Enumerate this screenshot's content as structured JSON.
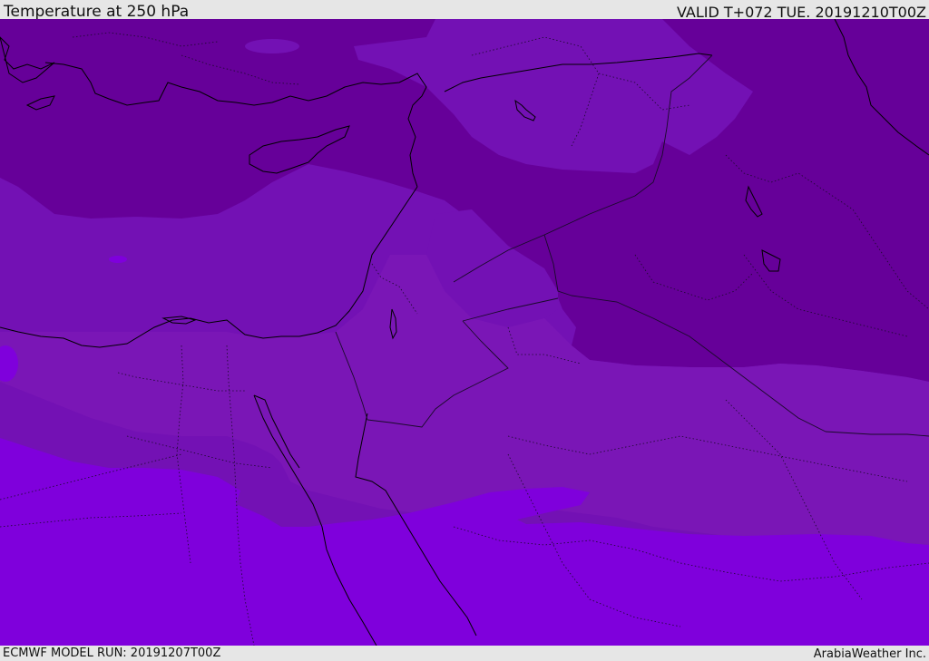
{
  "header": {
    "title": "Temperature at 250 hPa",
    "valid_time": "VALID T+072 TUE. 20191210T00Z"
  },
  "footer": {
    "model_run": "ECMWF MODEL RUN: 20191207T00Z",
    "credit": "ArabiaWeather Inc."
  },
  "map": {
    "colors": {
      "band_coldest": "#660099",
      "band_cold": "#7311b4",
      "band_mid": "#7a16b6",
      "band_warm": "#7f00dc",
      "coastline": "#000000",
      "border": "#1a0a2a"
    }
  }
}
